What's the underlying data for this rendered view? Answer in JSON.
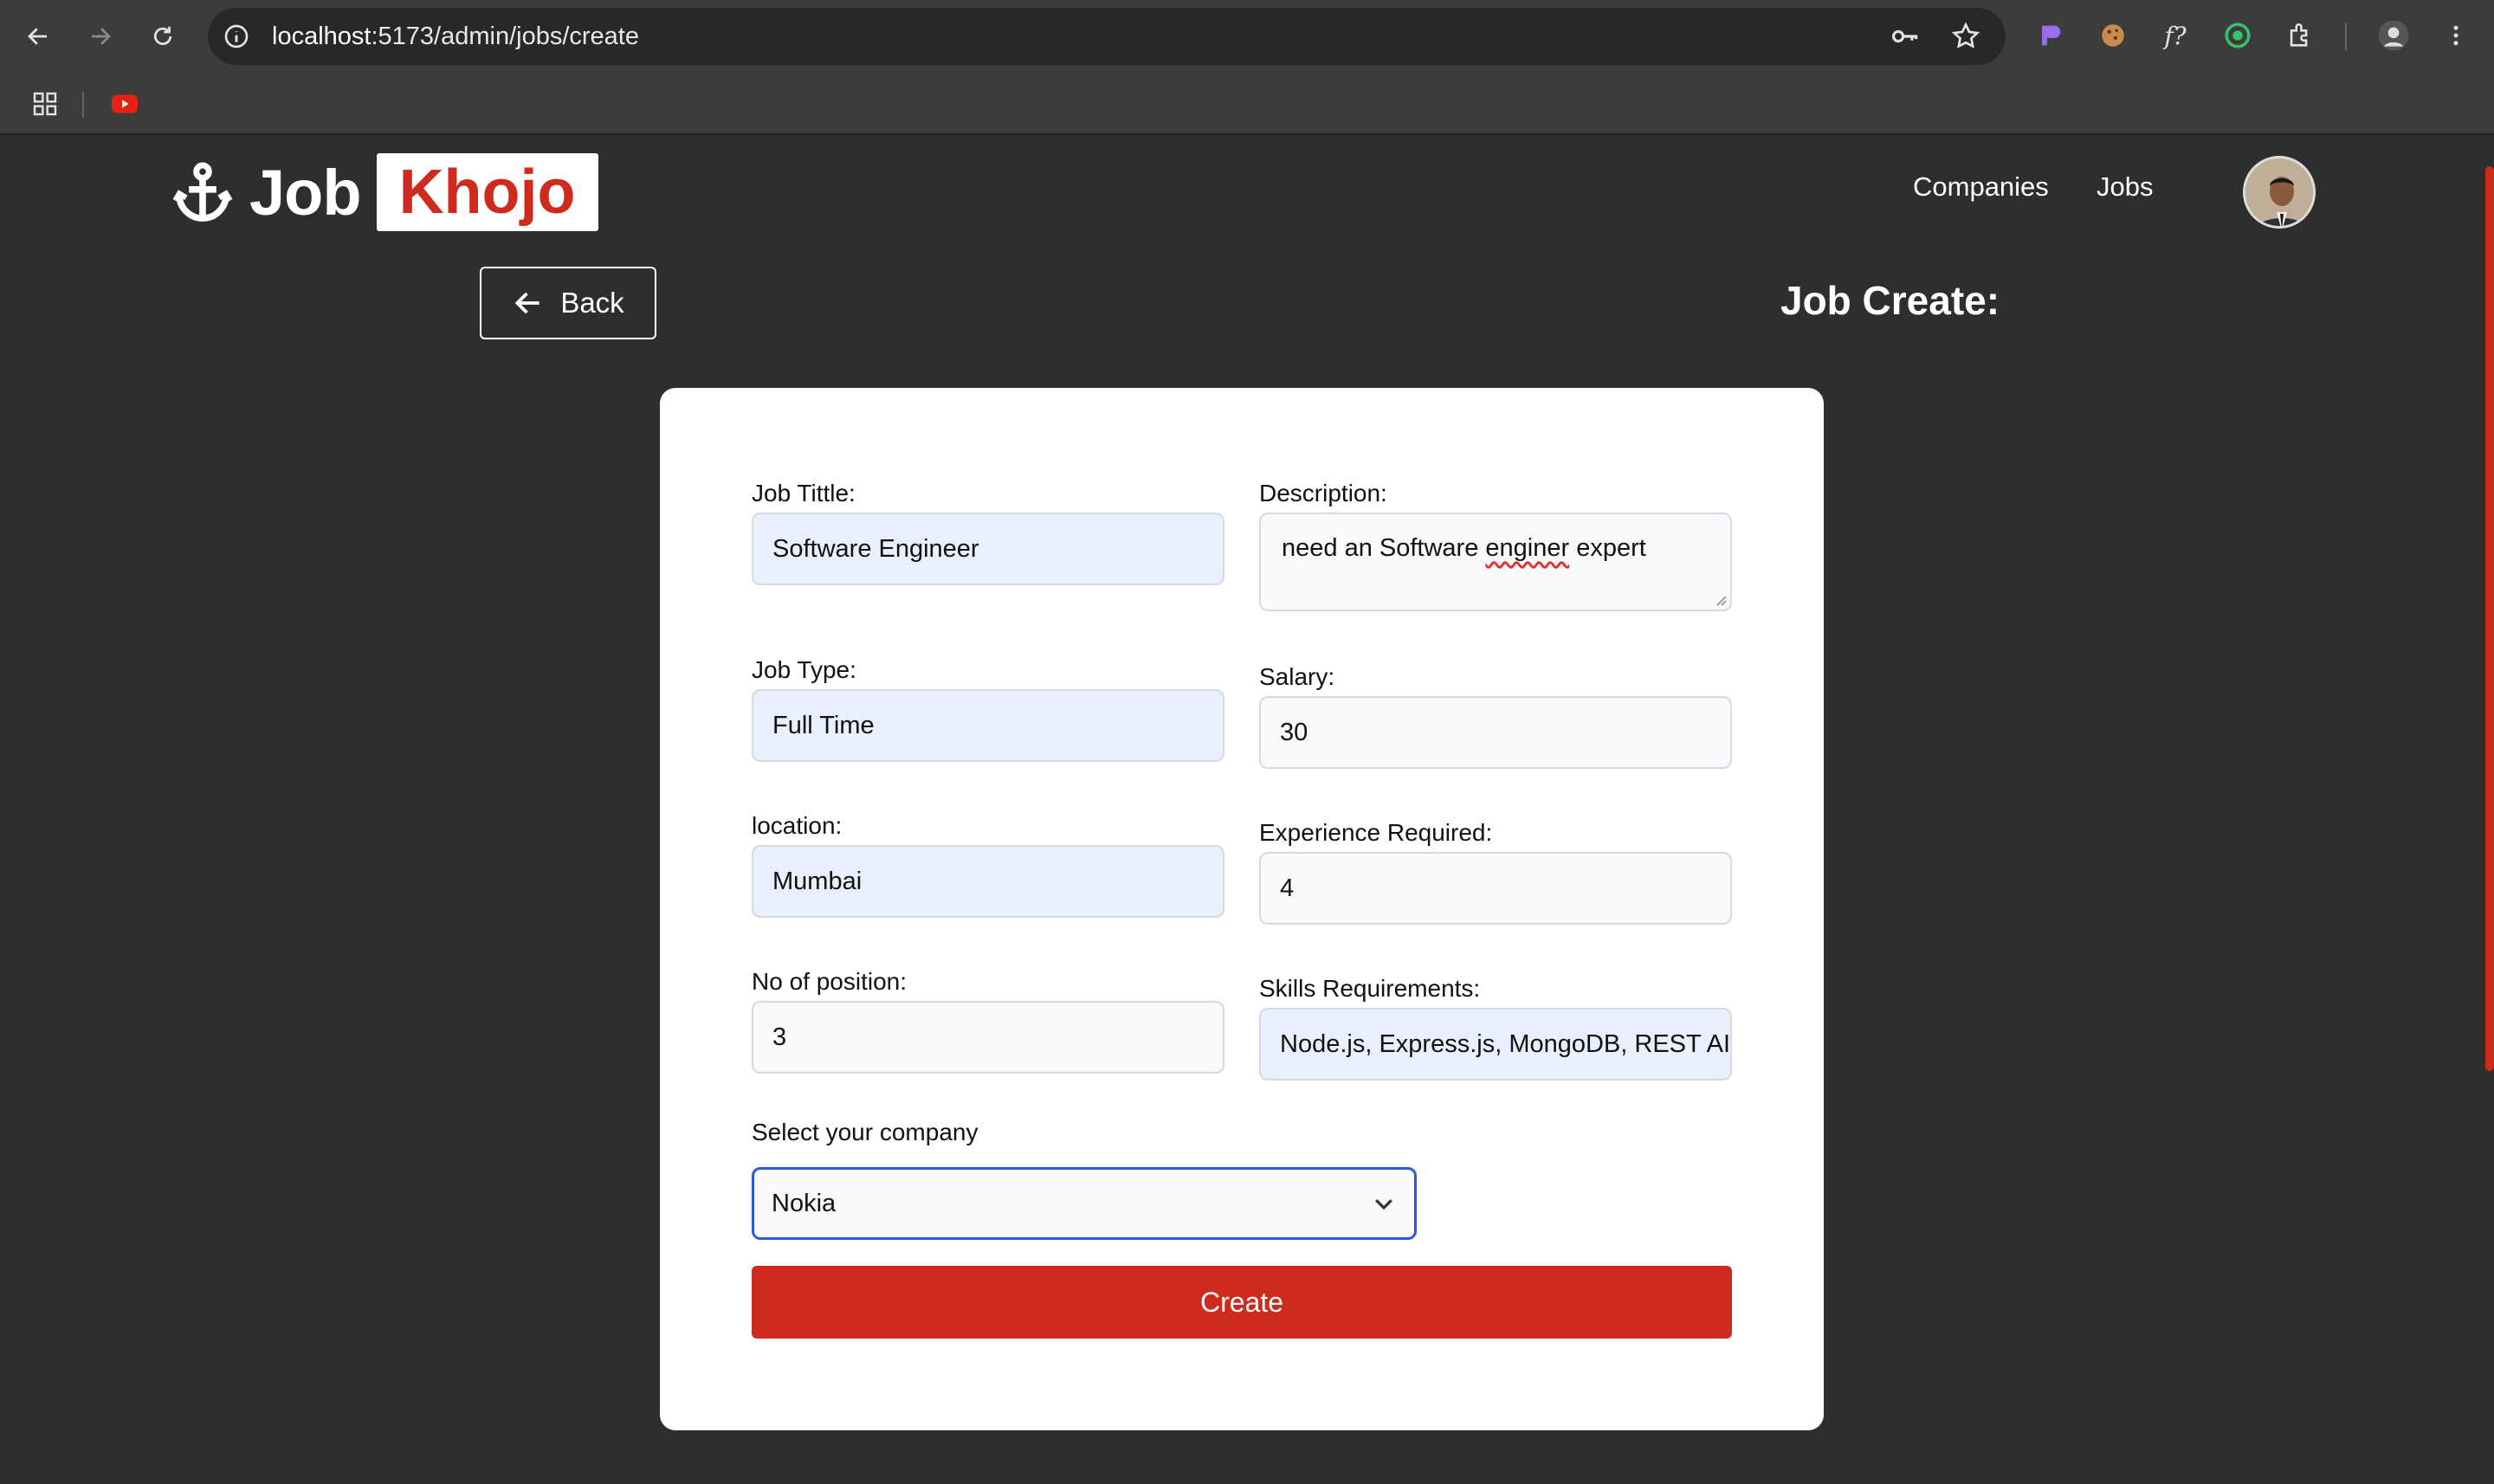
{
  "browser": {
    "url_host": "localhost",
    "url_path": ":5173/admin/jobs/create"
  },
  "brand": {
    "part1": "Job",
    "part2": "Khojo",
    "accent": "#cf2a1e"
  },
  "nav": {
    "companies": "Companies",
    "jobs": "Jobs"
  },
  "back_label": "Back",
  "page_title": "Job Create:",
  "form": {
    "title_label": "Job Tittle:",
    "title_value": "Software Engineer",
    "description_label": "Description:",
    "description_before": "need an Software ",
    "description_misspelled": "enginer",
    "description_after": " expert",
    "job_type_label": "Job Type:",
    "job_type_value": "Full Time",
    "salary_label": "Salary:",
    "salary_value": "30",
    "location_label": "location:",
    "location_value": "Mumbai",
    "experience_label": "Experience Required:",
    "experience_value": "4",
    "positions_label": "No of position:",
    "positions_value": "3",
    "skills_label": "Skills Requirements:",
    "skills_value": "Node.js, Express.js, MongoDB, REST AI",
    "company_label": "Select your company",
    "company_selected": "Nokia",
    "submit_label": "Create"
  }
}
